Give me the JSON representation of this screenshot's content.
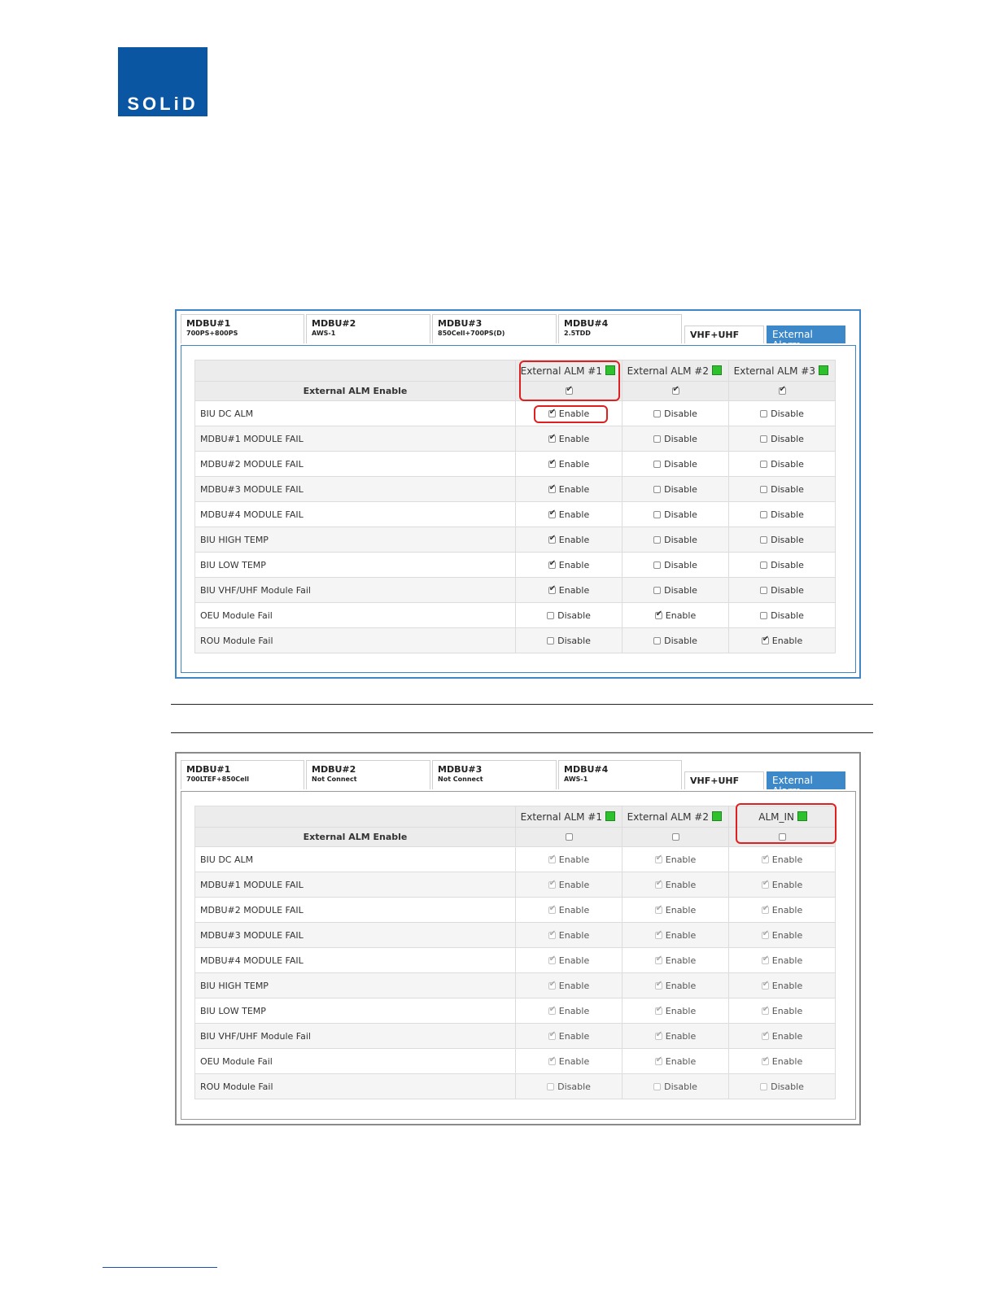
{
  "logo": {
    "text": "SOLiD"
  },
  "panel1": {
    "tabs": [
      {
        "name": "MDBU#1",
        "sub": "700PS+800PS"
      },
      {
        "name": "MDBU#2",
        "sub": "AWS-1"
      },
      {
        "name": "MDBU#3",
        "sub": "850Cell+700PS(D)"
      },
      {
        "name": "MDBU#4",
        "sub": "2.5TDD"
      }
    ],
    "tab_vhf": "VHF+UHF",
    "tab_active": "External Alarm",
    "header": {
      "enable_label": "External ALM Enable",
      "cols": [
        "External ALM #1",
        "External ALM #2",
        "External ALM #3"
      ]
    },
    "rows": [
      {
        "label": "BIU DC ALM",
        "c1": "Enable",
        "c2": "Disable",
        "c3": "Disable"
      },
      {
        "label": "MDBU#1 MODULE FAIL",
        "c1": "Enable",
        "c2": "Disable",
        "c3": "Disable"
      },
      {
        "label": "MDBU#2 MODULE FAIL",
        "c1": "Enable",
        "c2": "Disable",
        "c3": "Disable"
      },
      {
        "label": "MDBU#3 MODULE FAIL",
        "c1": "Enable",
        "c2": "Disable",
        "c3": "Disable"
      },
      {
        "label": "MDBU#4 MODULE FAIL",
        "c1": "Enable",
        "c2": "Disable",
        "c3": "Disable"
      },
      {
        "label": "BIU HIGH TEMP",
        "c1": "Enable",
        "c2": "Disable",
        "c3": "Disable"
      },
      {
        "label": "BIU LOW TEMP",
        "c1": "Enable",
        "c2": "Disable",
        "c3": "Disable"
      },
      {
        "label": "BIU VHF/UHF Module Fail",
        "c1": "Enable",
        "c2": "Disable",
        "c3": "Disable"
      },
      {
        "label": "OEU Module Fail",
        "c1": "Disable",
        "c2": "Enable",
        "c3": "Disable"
      },
      {
        "label": "ROU Module Fail",
        "c1": "Disable",
        "c2": "Disable",
        "c3": "Enable"
      }
    ]
  },
  "panel2": {
    "tabs": [
      {
        "name": "MDBU#1",
        "sub": "700LTEF+850Cell"
      },
      {
        "name": "MDBU#2",
        "sub": "Not Connect"
      },
      {
        "name": "MDBU#3",
        "sub": "Not Connect"
      },
      {
        "name": "MDBU#4",
        "sub": "AWS-1"
      }
    ],
    "tab_vhf": "VHF+UHF",
    "tab_active": "External Alarm",
    "header": {
      "enable_label": "External ALM Enable",
      "cols": [
        "External ALM #1",
        "External ALM #2",
        "ALM_IN"
      ]
    },
    "rows": [
      {
        "label": "BIU DC ALM",
        "c1": "Enable",
        "c2": "Enable",
        "c3": "Enable"
      },
      {
        "label": "MDBU#1 MODULE FAIL",
        "c1": "Enable",
        "c2": "Enable",
        "c3": "Enable"
      },
      {
        "label": "MDBU#2 MODULE FAIL",
        "c1": "Enable",
        "c2": "Enable",
        "c3": "Enable"
      },
      {
        "label": "MDBU#3 MODULE FAIL",
        "c1": "Enable",
        "c2": "Enable",
        "c3": "Enable"
      },
      {
        "label": "MDBU#4 MODULE FAIL",
        "c1": "Enable",
        "c2": "Enable",
        "c3": "Enable"
      },
      {
        "label": "BIU HIGH TEMP",
        "c1": "Enable",
        "c2": "Enable",
        "c3": "Enable"
      },
      {
        "label": "BIU LOW TEMP",
        "c1": "Enable",
        "c2": "Enable",
        "c3": "Enable"
      },
      {
        "label": "BIU VHF/UHF Module Fail",
        "c1": "Enable",
        "c2": "Enable",
        "c3": "Enable"
      },
      {
        "label": "OEU Module Fail",
        "c1": "Enable",
        "c2": "Enable",
        "c3": "Enable"
      },
      {
        "label": "ROU Module Fail",
        "c1": "Disable",
        "c2": "Disable",
        "c3": "Disable"
      }
    ]
  },
  "colors": {
    "accent": "#3c88c9",
    "ok": "#2dc22d",
    "highlight": "#e02020",
    "logo": "#0b56a3"
  }
}
